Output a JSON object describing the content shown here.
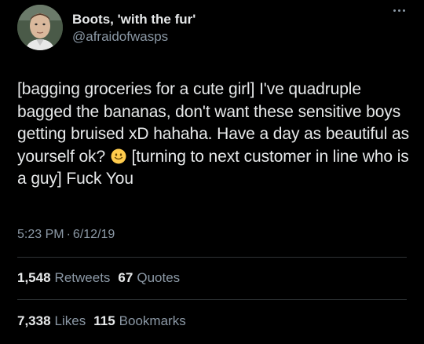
{
  "author": {
    "display_name": "Boots, 'with the fur'",
    "handle": "@afraidofwasps",
    "avatar_icon": "avatar-photo"
  },
  "more_icon": "more-horizontal-icon",
  "tweet": {
    "text_before_emoji": "[bagging groceries for a cute girl] I've quadruple bagged the bananas, don't want these sensitive boys getting bruised xD hahaha. Have a day as beautiful as yourself ok?",
    "emoji": "slightly-smiling-face-icon",
    "text_after_emoji": "[turning to next customer in line who is a guy] Fuck You"
  },
  "meta": {
    "time": "5:23 PM",
    "separator": "·",
    "date": "6/12/19"
  },
  "stats": {
    "retweets_count": "1,548",
    "retweets_label": "Retweets",
    "quotes_count": "67",
    "quotes_label": "Quotes",
    "likes_count": "7,338",
    "likes_label": "Likes",
    "bookmarks_count": "115",
    "bookmarks_label": "Bookmarks"
  },
  "colors": {
    "background": "#000000",
    "primary_text": "#e7e9ea",
    "secondary_text": "#8b98a5",
    "divider": "#2f3336"
  }
}
